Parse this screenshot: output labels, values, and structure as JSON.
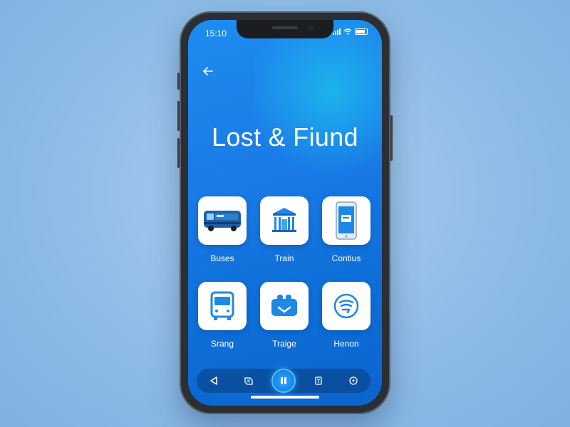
{
  "status_bar": {
    "time": "15:10"
  },
  "header": {
    "title": "Lost & Fiund"
  },
  "categories": [
    {
      "label": "Buses",
      "icon": "bus-icon"
    },
    {
      "label": "Train",
      "icon": "station-icon"
    },
    {
      "label": "Contius",
      "icon": "phone-icon"
    },
    {
      "label": "Srang",
      "icon": "bus-front-icon"
    },
    {
      "label": "Traige",
      "icon": "luggage-icon"
    },
    {
      "label": "Henon",
      "icon": "wifi-badge-icon"
    }
  ],
  "nav": {
    "items": [
      "back-nav-icon",
      "ticket-nav-icon",
      "pause-nav-icon",
      "card-nav-icon",
      "location-nav-icon"
    ]
  },
  "colors": {
    "accent": "#1a7ae6",
    "icon_blue": "#1565c0",
    "tile_bg": "#ffffff"
  }
}
